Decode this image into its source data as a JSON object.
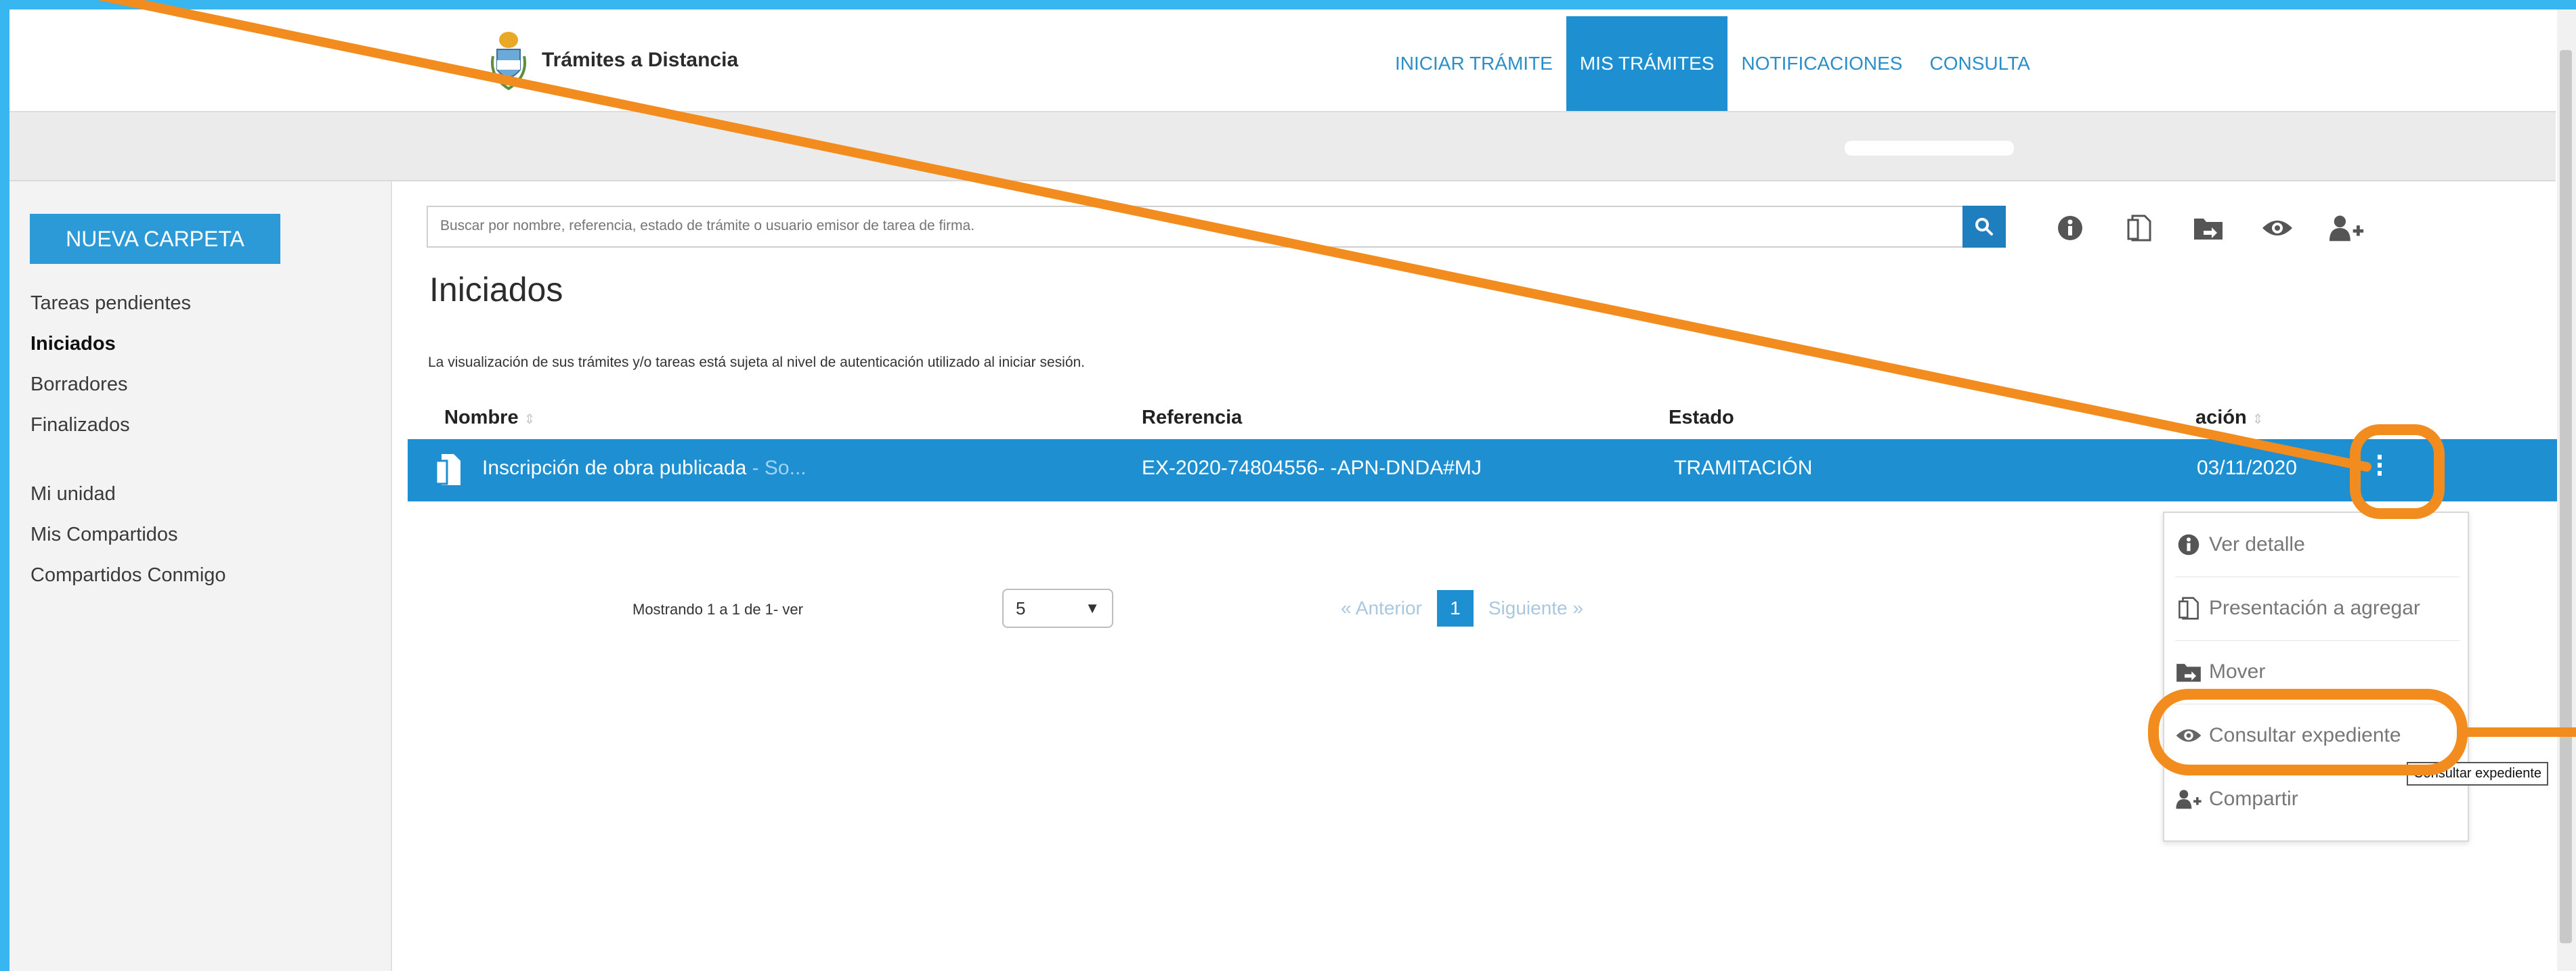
{
  "header": {
    "brand_name": "Trámites a Distancia",
    "nav": [
      {
        "label": "INICIAR TRÁMITE"
      },
      {
        "label": "MIS TRÁMITES"
      },
      {
        "label": "NOTIFICACIONES"
      },
      {
        "label": "CONSULTA"
      }
    ]
  },
  "sidebar": {
    "new_folder_label": "NUEVA CARPETA",
    "group1": [
      {
        "label": "Tareas pendientes"
      },
      {
        "label": "Iniciados"
      },
      {
        "label": "Borradores"
      },
      {
        "label": "Finalizados"
      }
    ],
    "group2": [
      {
        "label": "Mi unidad"
      },
      {
        "label": "Mis Compartidos"
      },
      {
        "label": "Compartidos Conmigo"
      }
    ]
  },
  "search": {
    "placeholder": "Buscar por nombre, referencia, estado de trámite o usuario emisor de tarea de firma."
  },
  "toolbar_icons": [
    "info-icon",
    "document-add-icon",
    "move-folder-icon",
    "eye-icon",
    "share-user-icon"
  ],
  "main": {
    "title": "Iniciados",
    "auth_note": "La visualización de sus trámites y/o tareas está sujeta al nivel de autenticación utilizado al iniciar sesión."
  },
  "table": {
    "columns": [
      "Nombre",
      "Referencia",
      "Estado",
      "ación"
    ],
    "rows": [
      {
        "nombre": "Inscripción de obra publicada",
        "nombre_suffix": " - So...",
        "referencia": "EX-2020-74804556- -APN-DNDA#MJ",
        "estado": "TRAMITACIÓN",
        "fecha": "03/11/2020"
      }
    ]
  },
  "pagination": {
    "info": "Mostrando 1 a 1 de 1- ver",
    "page_size": "5",
    "prev": "« Anterior",
    "current": "1",
    "next": "Siguiente »"
  },
  "row_menu": [
    {
      "label": "Ver detalle",
      "icon": "info-icon"
    },
    {
      "label": "Presentación a agregar",
      "icon": "document-add-icon"
    },
    {
      "label": "Mover",
      "icon": "move-folder-icon"
    },
    {
      "label": "Consultar expediente",
      "icon": "eye-icon"
    },
    {
      "label": "Compartir",
      "icon": "share-user-icon"
    }
  ],
  "tooltip": "Consultar expediente",
  "colors": {
    "brand_blue": "#1e8fd1",
    "annotation_orange": "#f28c1e",
    "frame_blue": "#38b6ef"
  }
}
